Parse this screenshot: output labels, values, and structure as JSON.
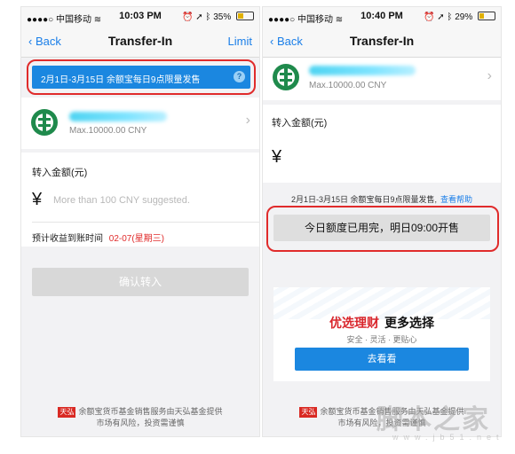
{
  "left_screen": {
    "status_bar": {
      "carrier": "中国移动",
      "time": "10:03 PM",
      "battery": "35%",
      "battery_level": 0.35
    },
    "nav": {
      "back": "Back",
      "title": "Transfer-In",
      "right": "Limit"
    },
    "notice_banner": "2月1日-3月15日 余额宝每日9点限量发售",
    "help_icon": "?",
    "bank": {
      "limit": "Max.10000.00 CNY"
    },
    "amount_label": "转入金额(元)",
    "currency_symbol": "¥",
    "amount_placeholder": "More than 100 CNY suggested.",
    "arrival_label": "预计收益到账时间",
    "arrival_date": "02-07(星期三)",
    "confirm_button": "确认转入",
    "footer": {
      "logo": "天弘",
      "line1": "余额宝货币基金销售服务由天弘基金提供",
      "line2": "市场有风险，投资需谨慎"
    }
  },
  "right_screen": {
    "status_bar": {
      "carrier": "中国移动",
      "time": "10:40 PM",
      "battery": "29%",
      "battery_level": 0.29
    },
    "nav": {
      "back": "Back",
      "title": "Transfer-In"
    },
    "bank": {
      "limit": "Max.10000.00 CNY"
    },
    "amount_label": "转入金额(元)",
    "currency_symbol": "¥",
    "notice_text": "2月1日-3月15日 余额宝每日9点限量发售,",
    "notice_link": "查看帮助",
    "quota_button": "今日额度已用完，明日09:00开售",
    "promo": {
      "title_red": "优选理财",
      "title_black": "更多选择",
      "subtitle": "安全 · 灵活 · 更贴心",
      "button": "去看看"
    },
    "footer": {
      "logo": "天弘",
      "line1": "余额宝货币基金销售服务由天弘基金提供",
      "line2": "市场有风险，投资需谨慎"
    }
  },
  "watermark": {
    "text": "脚本之家",
    "url": "www.jb51.net"
  },
  "colors": {
    "accent_blue": "#1b87e0",
    "link_blue": "#1a7ee8",
    "highlight_red": "#e02b2b",
    "bank_green": "#1f8a4c",
    "disabled_gray": "#d8d8d8"
  },
  "icons": [
    "wifi-icon",
    "alarm-icon",
    "location-arrow-icon",
    "bluetooth-icon",
    "battery-icon",
    "back-chevron-icon",
    "help-icon",
    "abc-bank-logo-icon",
    "chevron-right-icon",
    "tianhong-logo-icon"
  ]
}
